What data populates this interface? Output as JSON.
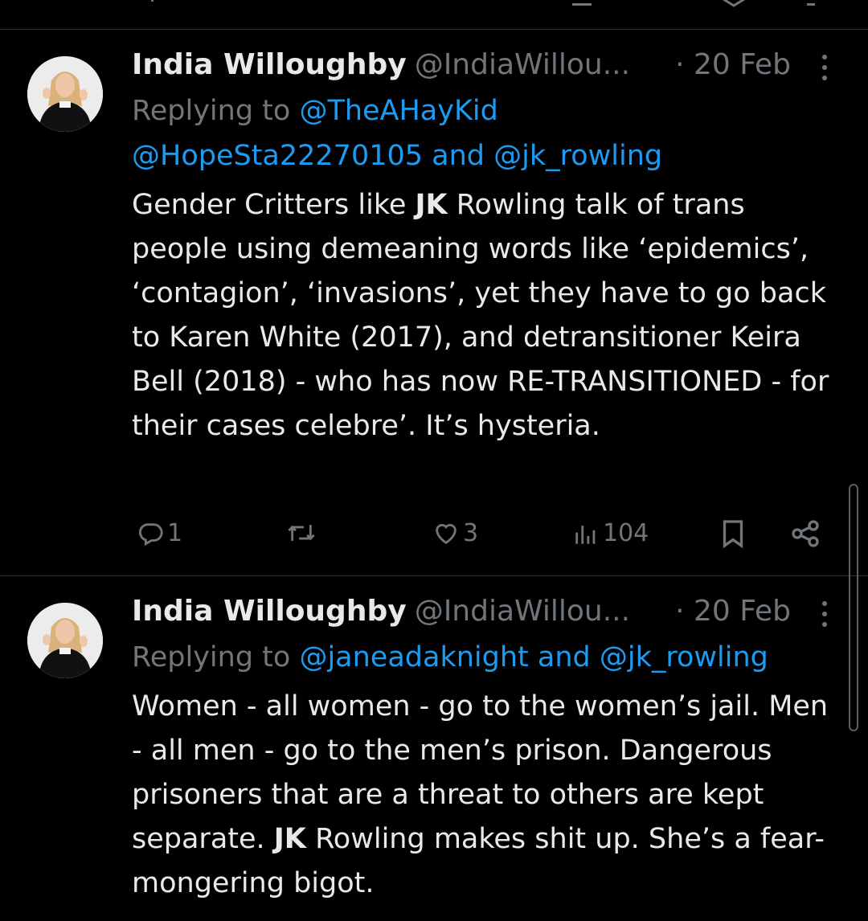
{
  "tweets": [
    {
      "name": "India Willoughby",
      "handle": "@IndiaWillou...",
      "date": "· 20 Feb",
      "replying_prefix": "Replying to ",
      "replying_links": [
        "@TheAHayKid",
        "@HopeSta22270105 and @jk_rowling"
      ],
      "text_pre_bold": "Gender Critters like ",
      "bold": "JK",
      "text_post_bold": " Rowling talk of trans people using demeaning words like ‘epidemics’,  ‘contagion’, ‘invasions’, yet they have to go back to Karen White (2017), and detransitioner Keira Bell (2018) - who has now RE-TRANSITIONED -  for their cases celebre’. It’s hysteria.",
      "replies": "1",
      "reposts": "",
      "likes": "3",
      "views": "104"
    },
    {
      "name": "India Willoughby",
      "handle": "@IndiaWillou...",
      "date": "· 20 Feb",
      "replying_prefix": "Replying to ",
      "replying_links": [
        "@janeadaknight and @jk_rowling"
      ],
      "text_pre_bold": "Women - all women - go to the women’s jail. Men - all men - go to the men’s prison. Dangerous prisoners that are a threat to others are kept separate. ",
      "bold": "JK",
      "text_post_bold": " Rowling makes shit up. She’s a fear-mongering bigot."
    }
  ],
  "icons": {
    "reply": "reply-icon",
    "repost": "repost-icon",
    "like": "heart-icon",
    "views": "views-icon",
    "bookmark": "bookmark-icon",
    "share": "share-icon",
    "more": "more-icon"
  },
  "colors": {
    "background": "#000000",
    "text": "#e7e9ea",
    "muted": "#71767b",
    "link": "#1d9bf0",
    "divider": "#2f3336"
  }
}
